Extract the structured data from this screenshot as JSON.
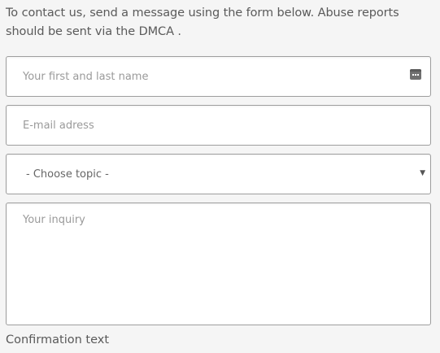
{
  "intro": {
    "text": "To contact us, send a message using the form below. Abuse reports should be sent via the ",
    "link": "DMCA",
    "suffix": " ."
  },
  "form": {
    "name_placeholder": "Your first and last name",
    "email_placeholder": "E-mail adress",
    "topic_selected": "- Choose topic -",
    "inquiry_placeholder": "Your inquiry",
    "confirmation_label": "Confirmation text"
  },
  "icons": {
    "autofill": "autofill-icon",
    "select_caret": "chevron-down-icon"
  }
}
